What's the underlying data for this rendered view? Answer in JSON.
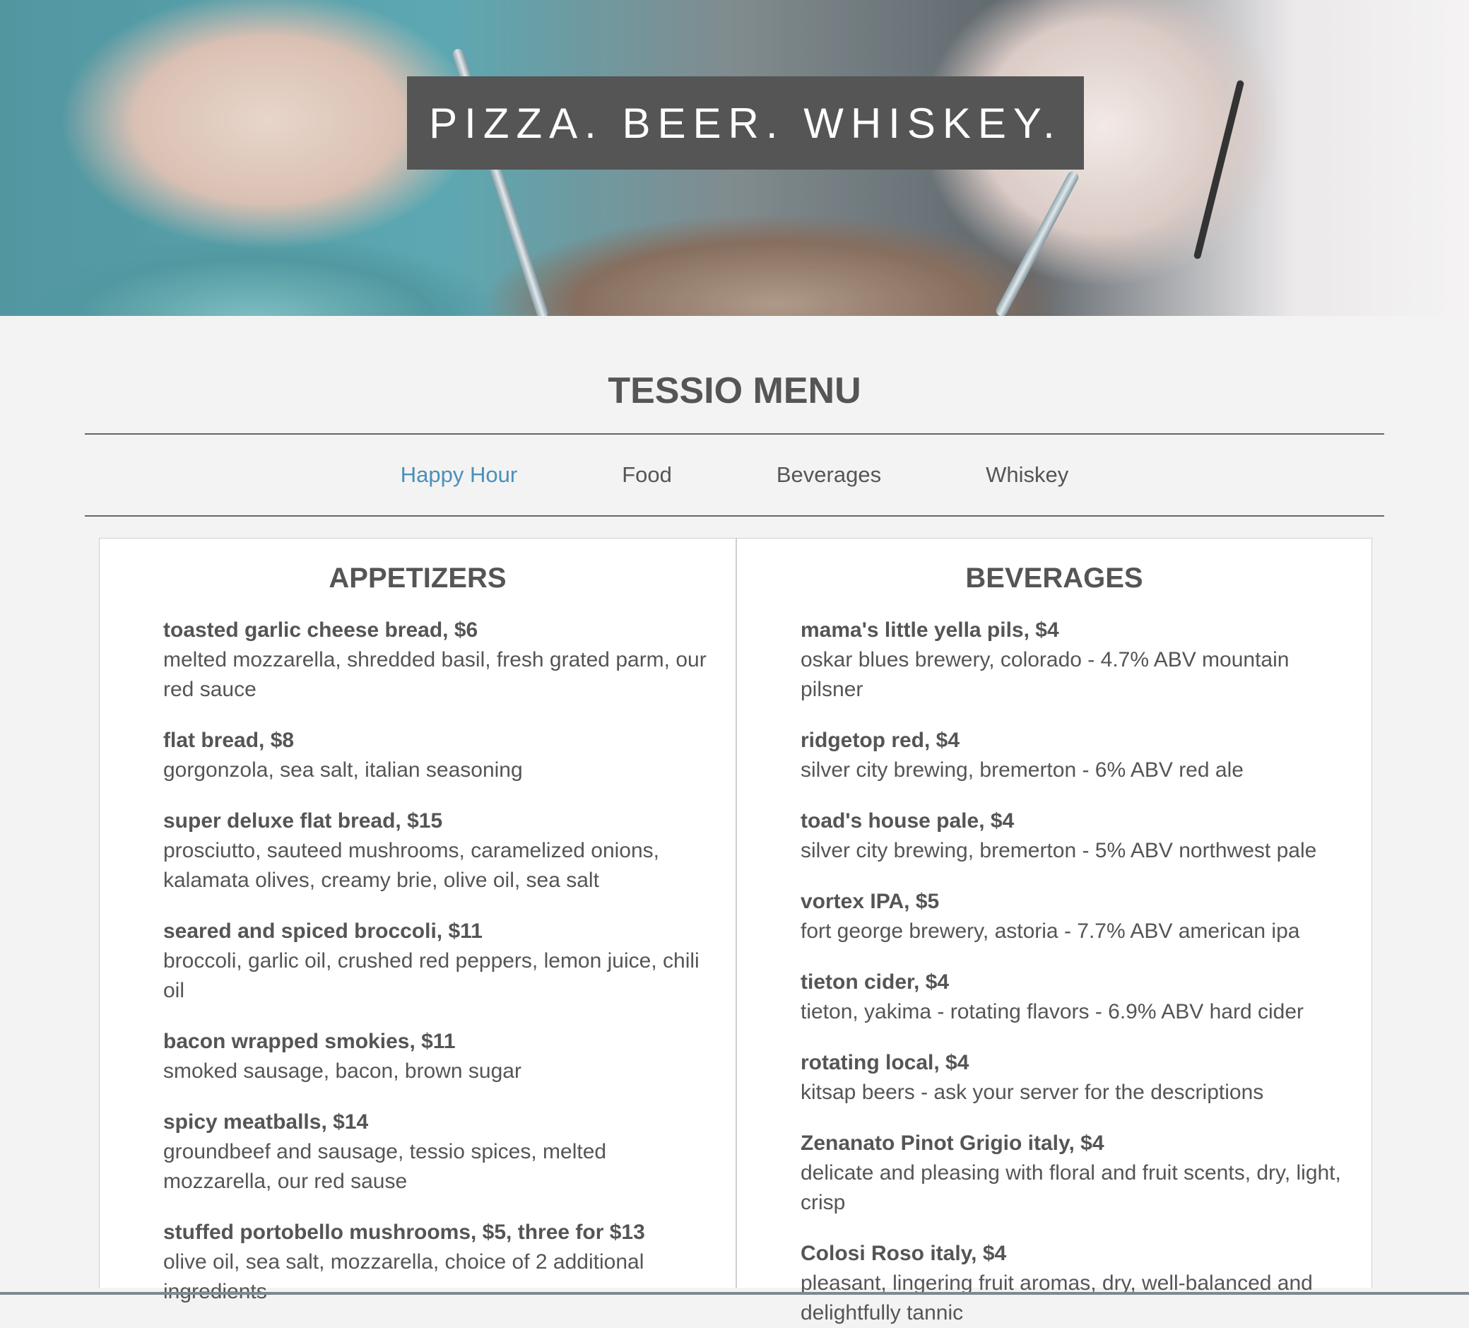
{
  "hero": {
    "title": "PIZZA. BEER. WHISKEY."
  },
  "page": {
    "title": "TESSIO MENU"
  },
  "nav": {
    "items": [
      {
        "label": "Happy Hour",
        "active": true
      },
      {
        "label": "Food",
        "active": false
      },
      {
        "label": "Beverages",
        "active": false
      },
      {
        "label": "Whiskey",
        "active": false
      }
    ]
  },
  "colors": {
    "accent": "#4a90b8",
    "banner": "#555555",
    "text": "#555555",
    "background": "#f3f3f3"
  },
  "appetizers": {
    "title": "APPETIZERS",
    "items": [
      {
        "name": "toasted garlic cheese bread, $6",
        "desc": "melted mozzarella, shredded basil, fresh grated parm, our red sauce"
      },
      {
        "name": "flat bread, $8",
        "desc": "gorgonzola, sea salt, italian seasoning"
      },
      {
        "name": "super deluxe flat bread, $15",
        "desc": "prosciutto, sauteed mushrooms, caramelized onions, kalamata olives, creamy brie, olive oil, sea salt"
      },
      {
        "name": "seared and spiced broccoli, $11",
        "desc": "broccoli, garlic oil, crushed red peppers, lemon juice, chili oil"
      },
      {
        "name": "bacon wrapped smokies, $11",
        "desc": "smoked sausage, bacon, brown sugar"
      },
      {
        "name": "spicy meatballs, $14",
        "desc": "groundbeef and sausage, tessio spices, melted mozzarella, our red sause"
      },
      {
        "name": "stuffed portobello mushrooms, $5, three for $13",
        "desc": "olive oil, sea salt, mozzarella, choice of 2 additional ingredients"
      }
    ]
  },
  "beverages": {
    "title": "BEVERAGES",
    "items": [
      {
        "name": "mama's little yella pils, $4",
        "desc": "oskar blues brewery, colorado - 4.7% ABV mountain pilsner"
      },
      {
        "name": "ridgetop red, $4",
        "desc": "silver city brewing, bremerton - 6% ABV red ale"
      },
      {
        "name": "toad's house pale, $4",
        "desc": "silver city brewing, bremerton - 5% ABV northwest pale"
      },
      {
        "name": "vortex IPA, $5",
        "desc": "fort george brewery, astoria - 7.7% ABV american ipa"
      },
      {
        "name": "tieton cider, $4",
        "desc": "tieton, yakima - rotating flavors - 6.9% ABV hard cider"
      },
      {
        "name": "rotating local, $4",
        "desc": "kitsap beers - ask your server for the descriptions"
      },
      {
        "name": "Zenanato Pinot Grigio italy, $4",
        "desc": "delicate and pleasing with floral and fruit scents, dry, light, crisp"
      },
      {
        "name": "Colosi Roso italy, $4",
        "desc": "pleasant, lingering fruit aromas, dry, well-balanced and delightfully tannic"
      }
    ]
  }
}
